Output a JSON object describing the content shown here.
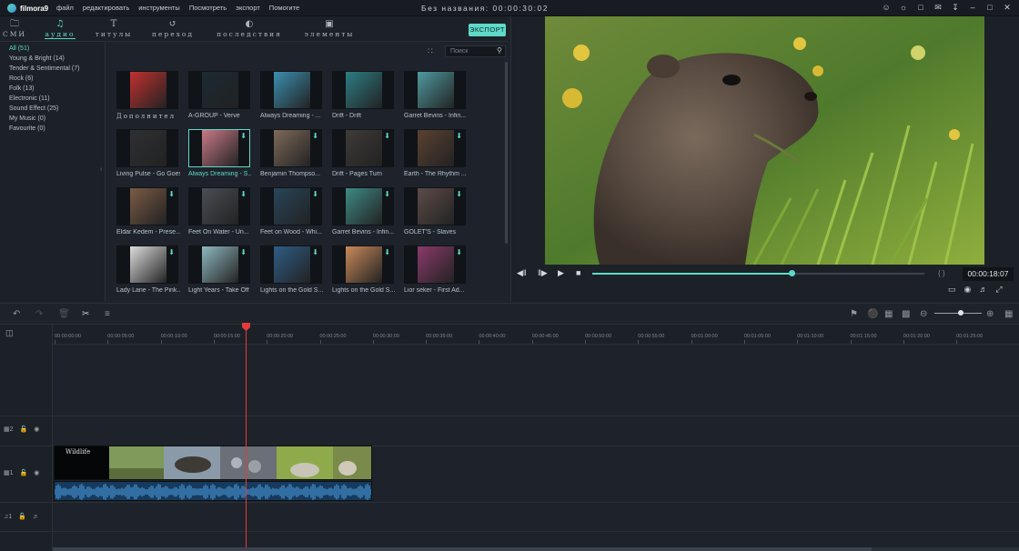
{
  "app": {
    "logo": "filmora9",
    "title": "Без названия:",
    "timecode": "00:00:30:02"
  },
  "menu": [
    "файл",
    "редактировать",
    "инструменты",
    "Посмотреть",
    "экспорт",
    "Помогите"
  ],
  "tabs": [
    {
      "label": "СМИ",
      "icon": "folder-icon"
    },
    {
      "label": "аудио",
      "icon": "music-note-icon"
    },
    {
      "label": "титулы",
      "icon": "text-icon"
    },
    {
      "label": "переход",
      "icon": "transition-icon"
    },
    {
      "label": "последствия",
      "icon": "effects-icon"
    },
    {
      "label": "элементы",
      "icon": "image-icon"
    }
  ],
  "export_label": "ЭКСПОРТ",
  "search_placeholder": "Поиск",
  "categories": [
    "All (51)",
    "Young & Bright (14)",
    "Tender & Sentimental (7)",
    "Rock (6)",
    "Folk (13)",
    "Electronic (11)",
    "Sound Effect (25)",
    "My Music (0)",
    "Favourite (0)"
  ],
  "media_items": [
    {
      "caption": "Дополнител",
      "color": "#c0312f",
      "download": false
    },
    {
      "caption": "A-GROUP - Verve",
      "color": "#1b2a33",
      "download": false
    },
    {
      "caption": "Always Dreaming - ...",
      "color": "#3c8fb0",
      "download": false
    },
    {
      "caption": "Drift - Drift",
      "color": "#2c7d84",
      "download": false
    },
    {
      "caption": "Garret Bevins - Infin...",
      "color": "#4f9aa0",
      "download": false
    },
    {
      "caption": "Living Pulse - Go Goes",
      "color": "#2f3033",
      "download": false
    },
    {
      "caption": "Always Dreaming - S...",
      "color": "#c97a86",
      "download": true
    },
    {
      "caption": "Benjamin Thompso...",
      "color": "#7d6a5a",
      "download": true
    },
    {
      "caption": "Drift - Pages Turn",
      "color": "#3e3a38",
      "download": true
    },
    {
      "caption": "Earth - The Rhythm ...",
      "color": "#5a4230",
      "download": true
    },
    {
      "caption": "Eldar Kedem - Prese...",
      "color": "#7a5b45",
      "download": true
    },
    {
      "caption": "Feet On Water - Un...",
      "color": "#4a4e55",
      "download": true
    },
    {
      "caption": "Feet on Wood - Whi...",
      "color": "#28455a",
      "download": true
    },
    {
      "caption": "Garret Bevins - Infin...",
      "color": "#3e8a84",
      "download": true
    },
    {
      "caption": "GOLET'S - Slaves",
      "color": "#5c4b48",
      "download": true
    },
    {
      "caption": "Lady Lane - The Pink...",
      "color": "#dcdcdc",
      "download": true
    },
    {
      "caption": "Light Years - Take Off",
      "color": "#8fb8c0",
      "download": true
    },
    {
      "caption": "Lights on the Gold S...",
      "color": "#2e5d86",
      "download": true
    },
    {
      "caption": "Lights on the Gold S...",
      "color": "#c9895a",
      "download": true
    },
    {
      "caption": "Lior seker - First Ad...",
      "color": "#8a3a6a",
      "download": true
    }
  ],
  "player": {
    "current_time": "00:00:18:07",
    "progress": 0.6,
    "braces": "{ }"
  },
  "ruler_labels": [
    "00:00:00:00",
    "00:00:05:00",
    "00:00:10:00",
    "00:00:15:00",
    "00:00:20:00",
    "00:00:25:00",
    "00:00:30:00",
    "00:00:35:00",
    "00:00:40:00",
    "00:00:45:00",
    "00:00:50:00",
    "00:00:55:00",
    "00:01:00:00",
    "00:01:05:00",
    "00:01:10:00",
    "00:01:15:00",
    "00:01:20:00",
    "00:01:25:00"
  ],
  "tracks": [
    {
      "label": "2",
      "kind": "video"
    },
    {
      "label": "1",
      "kind": "video"
    },
    {
      "label": "1",
      "kind": "audio"
    }
  ],
  "clip_title": "Wildlife",
  "zoom_level": 0.55
}
